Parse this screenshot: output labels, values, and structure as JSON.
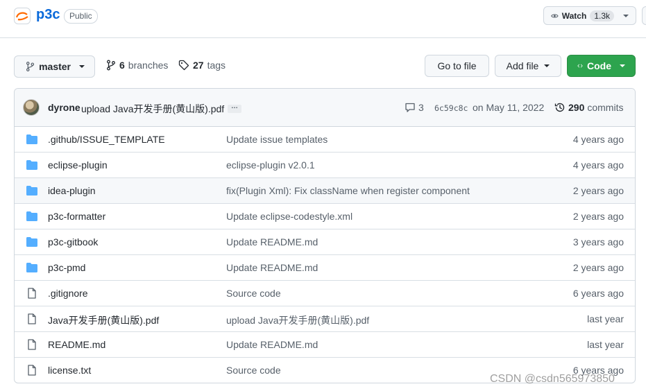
{
  "repo": {
    "name": "p3c",
    "visibility": "Public"
  },
  "watch": {
    "label": "Watch",
    "count": "1.3k"
  },
  "toolbar": {
    "branch": "master",
    "branches_count": "6",
    "branches_label": "branches",
    "tags_count": "27",
    "tags_label": "tags",
    "goto_file": "Go to file",
    "add_file": "Add file",
    "code": "Code"
  },
  "latest_commit": {
    "author": "dyrone",
    "message": "upload Java开发手册(黄山版).pdf",
    "ellipsis": "…",
    "comments": "3",
    "sha": "6c59c8c",
    "date": "on May 11, 2022",
    "commits_count": "290",
    "commits_label": "commits"
  },
  "files": [
    {
      "type": "folder",
      "name": ".github/ISSUE_TEMPLATE",
      "message": "Update issue templates",
      "age": "4 years ago"
    },
    {
      "type": "folder",
      "name": "eclipse-plugin",
      "message": "eclipse-plugin v2.0.1",
      "age": "4 years ago"
    },
    {
      "type": "folder",
      "name": "idea-plugin",
      "message": "fix(Plugin Xml): Fix className when register component",
      "age": "2 years ago"
    },
    {
      "type": "folder",
      "name": "p3c-formatter",
      "message": "Update eclipse-codestyle.xml",
      "age": "2 years ago"
    },
    {
      "type": "folder",
      "name": "p3c-gitbook",
      "message": "Update README.md",
      "age": "3 years ago"
    },
    {
      "type": "folder",
      "name": "p3c-pmd",
      "message": "Update README.md",
      "age": "2 years ago"
    },
    {
      "type": "file",
      "name": ".gitignore",
      "message": "Source code",
      "age": "6 years ago"
    },
    {
      "type": "file",
      "name": "Java开发手册(黄山版).pdf",
      "message": "upload Java开发手册(黄山版).pdf",
      "age": "last year"
    },
    {
      "type": "file",
      "name": "README.md",
      "message": "Update README.md",
      "age": "last year"
    },
    {
      "type": "file",
      "name": "license.txt",
      "message": "Source code",
      "age": "6 years ago"
    }
  ],
  "watermark": "CSDN @csdn565973850",
  "colors": {
    "link": "#0969da",
    "folder": "#54aeff",
    "code_button": "#2da44e",
    "muted": "#57606a"
  }
}
